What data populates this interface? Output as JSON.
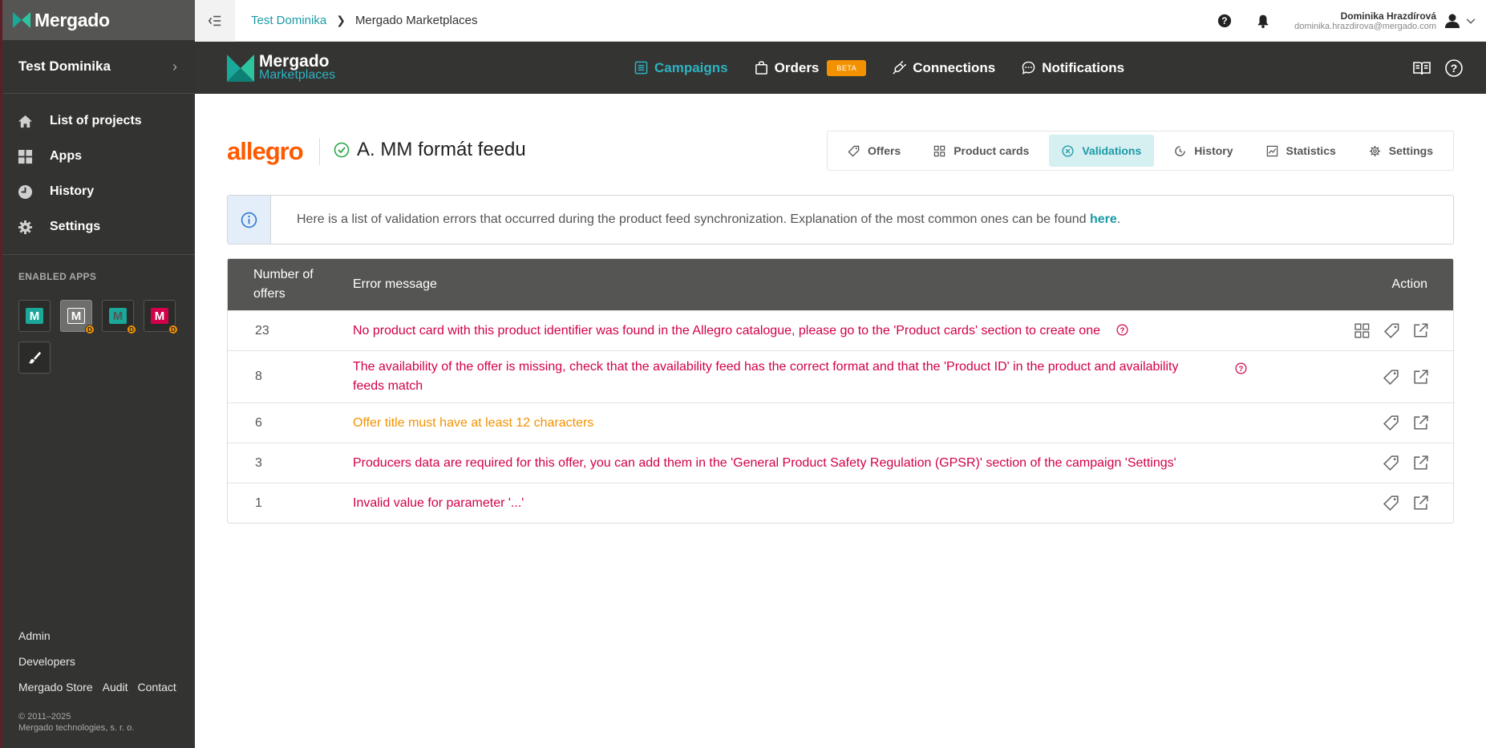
{
  "brand": {
    "name": "Mergado"
  },
  "sidebar": {
    "project_name": "Test Dominika",
    "nav": [
      {
        "label": "List of projects",
        "icon": "home-icon"
      },
      {
        "label": "Apps",
        "icon": "apps-grid-icon"
      },
      {
        "label": "History",
        "icon": "history-icon"
      },
      {
        "label": "Settings",
        "icon": "gear-icon"
      }
    ],
    "enabled_apps_title": "ENABLED APPS",
    "apps": [
      {
        "letter": "M",
        "color": "#1aa89a",
        "dev": false,
        "active": false
      },
      {
        "letter": "M",
        "color": "#7d7d7b",
        "dev": true,
        "active": true
      },
      {
        "letter": "M",
        "color": "#1aa89a",
        "dev": true,
        "active": false
      },
      {
        "letter": "M",
        "color": "#d2004a",
        "dev": true,
        "active": false
      }
    ],
    "dev_badge": "D",
    "footer": {
      "admin": "Admin",
      "developers": "Developers",
      "store": "Mergado Store",
      "audit": "Audit",
      "contact": "Contact",
      "copyright_years": "© 2011–2025",
      "copyright_company": "Mergado technologies, s. r. o."
    }
  },
  "topbar": {
    "breadcrumb": [
      "Test Dominika",
      "Mergado Marketplaces"
    ],
    "user_name": "Dominika Hrazdírová",
    "user_email": "dominika.hrazdirova@mergado.com"
  },
  "app_header": {
    "logo_line1": "Mergado",
    "logo_line2": "Marketplaces",
    "nav": [
      {
        "label": "Campaigns",
        "active": true
      },
      {
        "label": "Orders",
        "badge": "BETA"
      },
      {
        "label": "Connections"
      },
      {
        "label": "Notifications"
      }
    ]
  },
  "campaign": {
    "marketplace": "allegro",
    "name": "A. MM formát feedu"
  },
  "tabs": [
    {
      "label": "Offers",
      "icon": "tag-icon"
    },
    {
      "label": "Product cards",
      "icon": "cards-grid-icon"
    },
    {
      "label": "Validations",
      "icon": "circle-x-icon",
      "active": true
    },
    {
      "label": "History",
      "icon": "clock-icon"
    },
    {
      "label": "Statistics",
      "icon": "chart-icon"
    },
    {
      "label": "Settings",
      "icon": "gear-icon"
    }
  ],
  "info": {
    "text": "Here is a list of validation errors that occurred during the product feed synchronization. Explanation of the most common ones can be found ",
    "link": "here",
    "after": "."
  },
  "table": {
    "head_num_line1": "Number of",
    "head_num_line2": "offers",
    "head_msg": "Error message",
    "head_act": "Action",
    "rows": [
      {
        "count": "23",
        "message": "No product card with this product identifier was found in the Allegro catalogue, please go to the 'Product cards' section to create one",
        "severity": "error",
        "help": true,
        "actions": [
          "cards-grid-icon",
          "tag-icon",
          "external-link-icon"
        ]
      },
      {
        "count": "8",
        "message": "The availability of the offer is missing, check that the availability feed has the correct format and that the 'Product ID' in the product and availability feeds match",
        "severity": "error",
        "help": true,
        "actions": [
          "tag-icon",
          "external-link-icon"
        ]
      },
      {
        "count": "6",
        "message": "Offer title must have at least 12 characters",
        "severity": "warning",
        "help": false,
        "actions": [
          "tag-icon",
          "external-link-icon"
        ]
      },
      {
        "count": "3",
        "message": "Producers data are required for this offer, you can add them in the 'General Product Safety Regulation (GPSR)' section of the campaign 'Settings'",
        "severity": "error",
        "help": false,
        "actions": [
          "tag-icon",
          "external-link-icon"
        ]
      },
      {
        "count": "1",
        "message": "Invalid value for parameter '...'",
        "severity": "error",
        "help": false,
        "actions": [
          "tag-icon",
          "external-link-icon"
        ]
      }
    ]
  },
  "colors": {
    "accent": "#1a9aa6",
    "error": "#d2004a",
    "warning": "#f39200",
    "allegro": "#ff5a00"
  }
}
